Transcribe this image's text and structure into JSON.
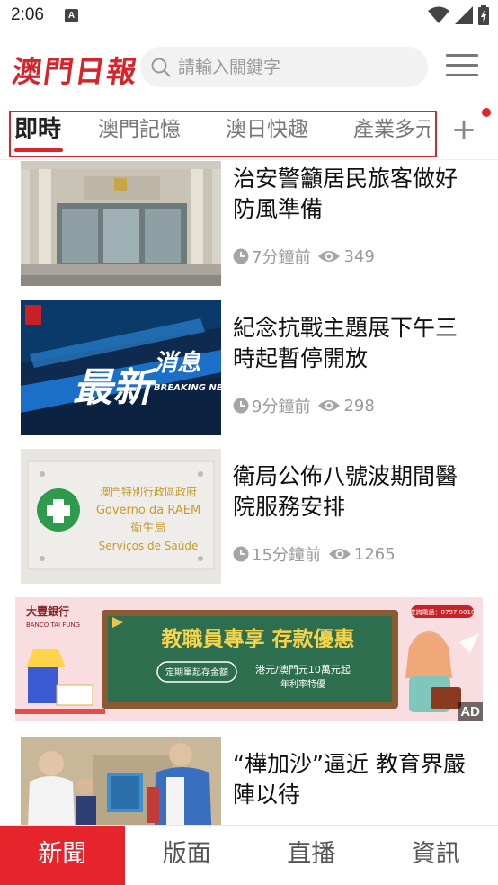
{
  "status_bar": {
    "time": "2:06",
    "notif_glyph": "A"
  },
  "header": {
    "logo_text": "澳門日報",
    "search_placeholder": "請輸入關鍵字"
  },
  "tabs": [
    {
      "label": "即時",
      "active": true
    },
    {
      "label": "澳門記憶",
      "active": false
    },
    {
      "label": "澳日快趣",
      "active": false
    },
    {
      "label": "產業多元",
      "active": false
    }
  ],
  "tab_add_label": "+",
  "news": [
    {
      "title": "治安警籲居民旅客做好防風準備",
      "time": "7分鐘前",
      "views": "349",
      "image": "building-photo"
    },
    {
      "title": "紀念抗戰主題展下午三時起暫停開放",
      "time": "9分鐘前",
      "views": "298",
      "image": "breaking-news-graphic",
      "image_text": {
        "main": "最新",
        "sub": "消息",
        "en": "BREAKING NEWS"
      }
    },
    {
      "title": "衛局公佈八號波期間醫院服務安排",
      "time": "15分鐘前",
      "views": "1265",
      "image": "health-bureau-sign",
      "image_text": {
        "line1": "澳門特別行政區政府",
        "line2": "Governo da RAEM",
        "line3": "衛生局",
        "line4": "Serviços de Saúde"
      }
    },
    {
      "title": "“樺加沙”逼近 教育界嚴陣以待",
      "time": "",
      "views": "",
      "image": "people-photo"
    }
  ],
  "ad": {
    "bank_name": "大豐銀行",
    "bank_name_en": "BANCO TAI FUNG",
    "hotline": "查詢電話：8797 0018",
    "headline": "教職員專享 存款優惠",
    "pill_text": "定期單起存金額",
    "line1": "港元/澳門元10萬元起",
    "line2": "年利率特優",
    "tag": "AD"
  },
  "bottom_nav": [
    {
      "label": "新聞",
      "active": true
    },
    {
      "label": "版面",
      "active": false
    },
    {
      "label": "直播",
      "active": false
    },
    {
      "label": "資訊",
      "active": false
    }
  ],
  "colors": {
    "brand_red": "#d9262d",
    "nav_active": "#e5242b",
    "meta_gray": "#9a9a9a"
  }
}
